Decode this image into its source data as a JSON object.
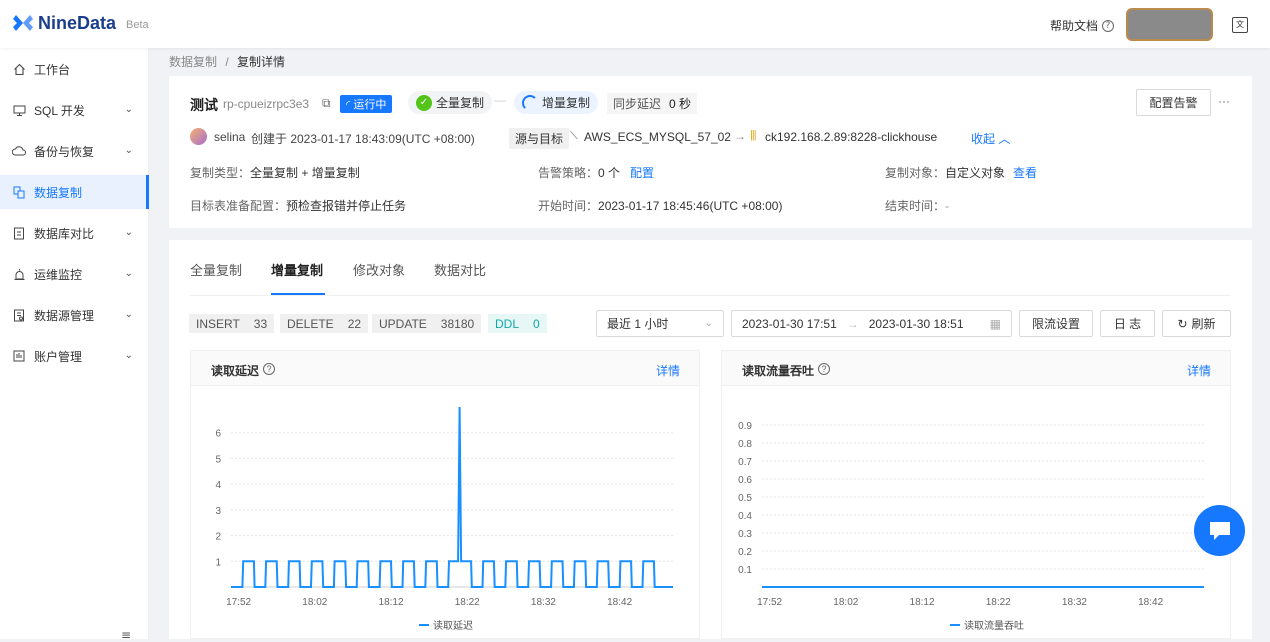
{
  "brand": {
    "name": "NineData",
    "beta": "Beta"
  },
  "header": {
    "help": "帮助文档"
  },
  "sidebar": {
    "items": [
      {
        "label": "工作台",
        "icon": "home-icon",
        "chevron": false
      },
      {
        "label": "SQL 开发",
        "icon": "monitor-icon",
        "chevron": true
      },
      {
        "label": "备份与恢复",
        "icon": "cloud-icon",
        "chevron": true
      },
      {
        "label": "数据复制",
        "icon": "replicate-icon",
        "chevron": false,
        "active": true
      },
      {
        "label": "数据库对比",
        "icon": "compare-icon",
        "chevron": true
      },
      {
        "label": "运维监控",
        "icon": "alarm-icon",
        "chevron": true
      },
      {
        "label": "数据源管理",
        "icon": "datasource-icon",
        "chevron": true
      },
      {
        "label": "账户管理",
        "icon": "account-icon",
        "chevron": true
      }
    ]
  },
  "breadcrumb": {
    "parent": "数据复制",
    "sep": "/",
    "current": "复制详情"
  },
  "task": {
    "name": "测试",
    "id": "rp-cpueizrpc3e3",
    "status": "运行中",
    "stage_full": "全量复制",
    "stage_incr": "增量复制",
    "delay_label": "同步延迟",
    "delay_value": "0 秒",
    "alert_button": "配置告警",
    "more": "···",
    "creator": "selina",
    "created_text": "创建于 2023-01-17 18:43:09(UTC +08:00)",
    "src_tgt_label": "源与目标",
    "source": "AWS_ECS_MYSQL_57_02",
    "target": "ck192.168.2.89:8228-clickhouse",
    "collapse": "收起",
    "type_label": "复制类型：",
    "type_value": "全量复制 + 增量复制",
    "policy_label": "告警策略：",
    "policy_value": "0 个",
    "policy_link": "配置",
    "object_label": "复制对象：",
    "object_value": "自定义对象",
    "object_link": "查看",
    "prep_label": "目标表准备配置：",
    "prep_value": "预检查报错并停止任务",
    "start_label": "开始时间：",
    "start_value": "2023-01-17 18:45:46(UTC +08:00)",
    "end_label": "结束时间：",
    "end_value": "-"
  },
  "tabs": [
    "全量复制",
    "增量复制",
    "修改对象",
    "数据对比"
  ],
  "active_tab": 1,
  "stats": [
    {
      "label": "INSERT",
      "value": "33"
    },
    {
      "label": "DELETE",
      "value": "22"
    },
    {
      "label": "UPDATE",
      "value": "38180"
    },
    {
      "label": "DDL",
      "value": "0"
    }
  ],
  "toolbar": {
    "range_select": "最近 1 小时",
    "start": "2023-01-30 17:51",
    "arrow": "→",
    "end": "2023-01-30 18:51",
    "limit": "限流设置",
    "log": "日 志",
    "refresh": "刷新"
  },
  "chart_data": [
    {
      "type": "line",
      "title": "读取延迟",
      "detail_link": "详情",
      "legend": "读取延迟",
      "x_ticks": [
        "17:52",
        "18:02",
        "18:12",
        "18:22",
        "18:32",
        "18:42"
      ],
      "y_ticks": [
        1,
        2,
        3,
        4,
        5,
        6
      ],
      "ylim": [
        0,
        7
      ],
      "series": [
        {
          "name": "读取延迟",
          "color": "#1890ff"
        }
      ],
      "x_minutes": [
        0,
        1.5,
        1.6,
        3,
        3.1,
        4.5,
        4.6,
        6,
        6.1,
        7.5,
        7.6,
        9,
        9.1,
        10.5,
        10.6,
        12,
        12.1,
        13.5,
        13.6,
        15,
        15.1,
        16.5,
        16.6,
        18,
        18.1,
        19.5,
        19.6,
        21,
        21.1,
        22.5,
        22.6,
        24,
        24.1,
        25.5,
        25.6,
        27,
        27.1,
        28.5,
        28.6,
        29.8,
        30,
        30.2,
        31.5,
        31.6,
        33,
        33.1,
        34.5,
        34.6,
        36,
        36.1,
        37.5,
        37.6,
        39,
        39.1,
        40.5,
        40.6,
        42,
        42.1,
        43.5,
        43.6,
        45,
        45.1,
        46.5,
        46.6,
        48,
        48.1,
        49.5,
        49.6,
        51,
        51.1,
        52.5,
        52.6,
        54,
        54.1,
        55.5,
        55.6,
        58
      ],
      "y_values": [
        0,
        0,
        1,
        1,
        0,
        0,
        1,
        1,
        0,
        0,
        1,
        1,
        0,
        0,
        1,
        1,
        0,
        0,
        1,
        1,
        0,
        0,
        1,
        1,
        0,
        0,
        1,
        1,
        0,
        0,
        1,
        1,
        0,
        0,
        1,
        1,
        0,
        0,
        1,
        1,
        7,
        1,
        1,
        0,
        0,
        1,
        1,
        0,
        0,
        1,
        1,
        0,
        0,
        1,
        1,
        0,
        0,
        1,
        1,
        0,
        0,
        1,
        1,
        0,
        0,
        1,
        1,
        0,
        0,
        1,
        1,
        0,
        0,
        1,
        1,
        0,
        0
      ]
    },
    {
      "type": "line",
      "title": "读取流量吞吐",
      "detail_link": "详情",
      "legend": "读取流量吞吐",
      "x_ticks": [
        "17:52",
        "18:02",
        "18:12",
        "18:22",
        "18:32",
        "18:42"
      ],
      "y_ticks": [
        0.1,
        0.2,
        0.3,
        0.4,
        0.5,
        0.6,
        0.7,
        0.8,
        0.9
      ],
      "ylim": [
        0,
        1
      ],
      "series": [
        {
          "name": "读取流量吞吐",
          "color": "#1890ff"
        }
      ],
      "x_minutes": [
        0,
        58
      ],
      "y_values": [
        0,
        0
      ]
    }
  ]
}
